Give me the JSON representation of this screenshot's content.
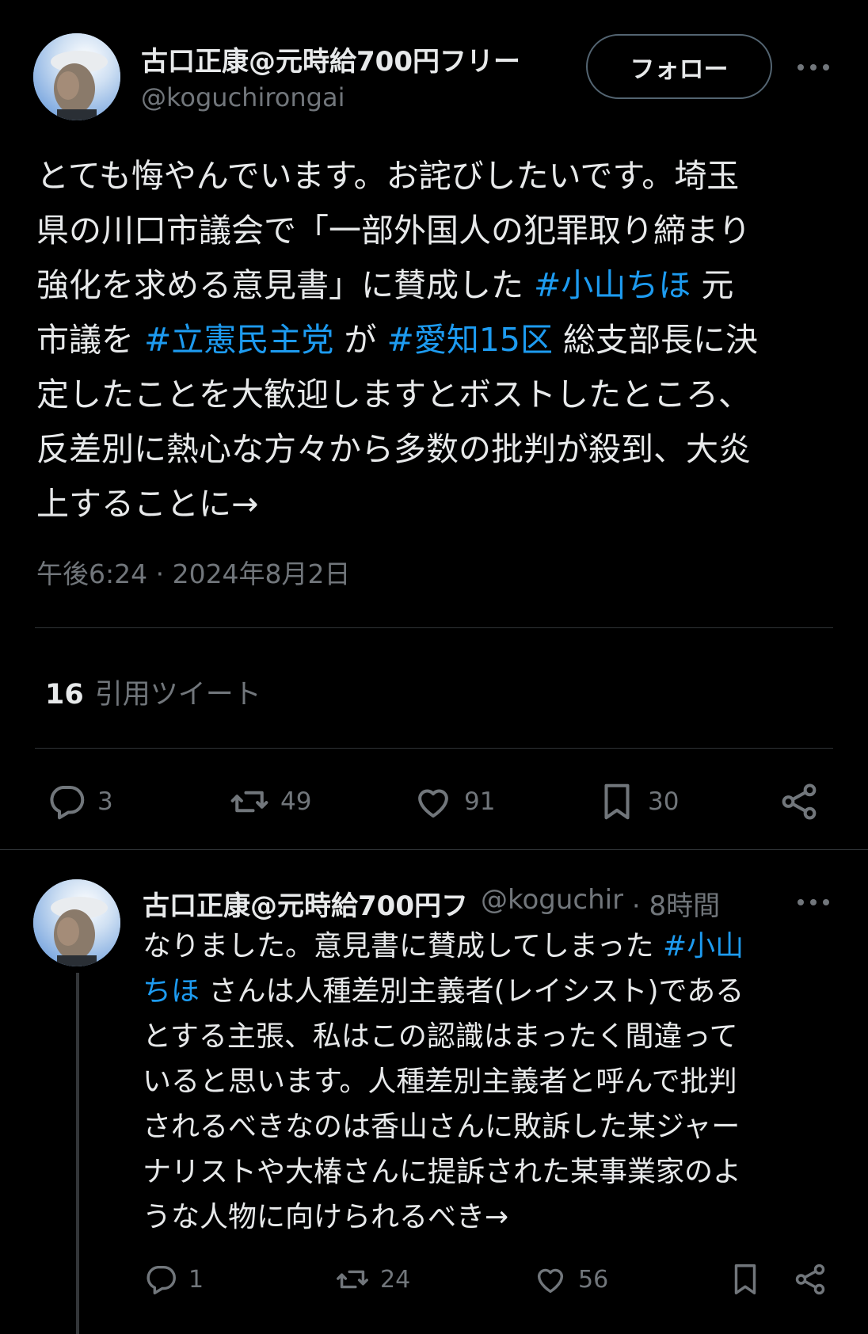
{
  "main_tweet": {
    "author": {
      "name": "古口正康@元時給700円フリー",
      "handle": "@koguchirongai"
    },
    "follow_label": "フォロー",
    "text": {
      "part1": "とても悔やんでいます。お詫びしたいです。埼玉\n県の川口市議会で「一部外国人の犯罪取り締まり\n強化を求める意見書」に賛成した ",
      "tag1": "#小山ちほ",
      "part2": " 元\n市議を ",
      "tag2": "#立憲民主党",
      "part3": " が ",
      "tag3": "#愛知15区",
      "part4": " 総支部長に決\n定したことを大歓迎しますとボストしたところ、\n反差別に熱心な方々から多数の批判が殺到、大炎\n上することに→"
    },
    "timestamp": "午後6:24 · 2024年8月2日",
    "quote_count": "16",
    "quote_label": "引用ツイート",
    "actions": {
      "replies": "3",
      "retweets": "49",
      "likes": "91",
      "bookmarks": "30"
    }
  },
  "reply_tweet": {
    "author": {
      "name": "古口正康@元時給700円フ",
      "handle": "@koguchir"
    },
    "separator": "·",
    "time": "8時間",
    "text": {
      "part1": "なりました。意見書に賛成してしまった ",
      "tag1": "#小山\nちほ",
      "part2": " さんは人種差別主義者(レイシスト)である\nとする主張、私はこの認識はまったく間違って\nいると思います。人種差別主義者と呼んで批判\nされるべきなのは香山さんに敗訴した某ジャー\nナリストや大椿さんに提訴された某事業家のよ\nうな人物に向けられるべき→"
    },
    "actions": {
      "replies": "1",
      "retweets": "24",
      "likes": "56"
    }
  },
  "colors": {
    "background": "#000000",
    "text": "#e7e9ea",
    "secondary": "#71767b",
    "link": "#1d9bf0",
    "divider": "#2f3336"
  }
}
